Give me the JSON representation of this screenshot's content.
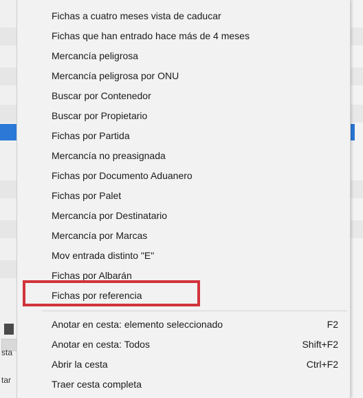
{
  "menu": {
    "items": [
      {
        "label": "Fichas a cuatro meses vista de caducar"
      },
      {
        "label": "Fichas que han entrado hace más de 4 meses"
      },
      {
        "label": "Mercancía peligrosa"
      },
      {
        "label": "Mercancía peligrosa por ONU"
      },
      {
        "label": "Buscar por Contenedor"
      },
      {
        "label": "Buscar por Propietario"
      },
      {
        "label": "Fichas por Partida"
      },
      {
        "label": "Mercancía no preasignada"
      },
      {
        "label": "Fichas por Documento Aduanero"
      },
      {
        "label": "Fichas por Palet"
      },
      {
        "label": "Mercancía por Destinatario"
      },
      {
        "label": "Mercancía por Marcas"
      },
      {
        "label": "Mov entrada distinto \"E\""
      },
      {
        "label": "Fichas por Albarán"
      },
      {
        "label": "Fichas por referencia"
      }
    ],
    "basket_items": [
      {
        "label": "Anotar en cesta: elemento seleccionado",
        "shortcut": "F2"
      },
      {
        "label": "Anotar en cesta: Todos",
        "shortcut": "Shift+F2"
      },
      {
        "label": "Abrir la cesta",
        "shortcut": "Ctrl+F2"
      },
      {
        "label": "Traer cesta completa",
        "shortcut": ""
      }
    ],
    "highlighted_item": "Fichas por referencia",
    "highlight_color": "#d2343c"
  },
  "background": {
    "left_texts": [
      "sta",
      "tar"
    ],
    "selection_color": "#2b78d6"
  }
}
